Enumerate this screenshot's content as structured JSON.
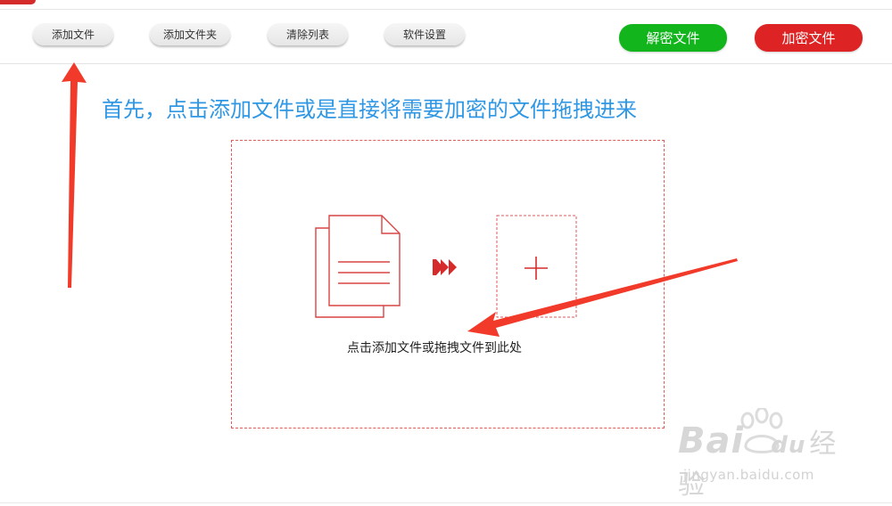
{
  "toolbar": {
    "add_file": "添加文件",
    "add_folder": "添加文件夹",
    "clear_list": "清除列表",
    "settings": "软件设置",
    "decrypt": "解密文件",
    "encrypt": "加密文件"
  },
  "instruction": "首先，点击添加文件或是直接将需要加密的文件拖拽进来",
  "drop_zone": {
    "hint": "点击添加文件或拖拽文件到此处",
    "file_icon": "document-icon",
    "arrow_icon": "triple-chevron-right-icon",
    "plus_icon": "plus-icon"
  },
  "watermark": {
    "brand_prefix": "Bai",
    "brand_suffix": "du",
    "brand_cn": "经验",
    "url": "jingyan.baidu.com"
  },
  "colors": {
    "accent_blue": "#2f97e4",
    "green": "#12b51c",
    "red": "#dd2323",
    "dashed": "#e05a5a"
  }
}
